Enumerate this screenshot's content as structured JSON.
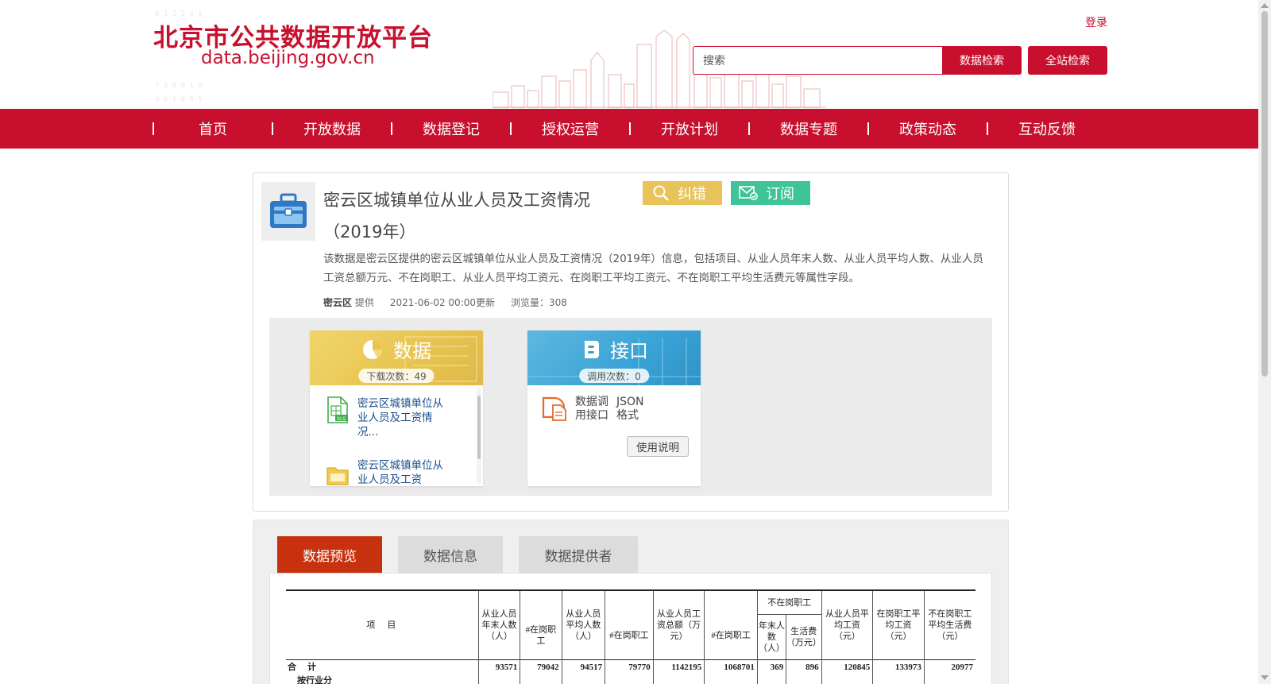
{
  "header": {
    "site_title": "北京市公共数据开放平台",
    "site_url": "data.beijing.gov.cn",
    "login_label": "登录",
    "search_placeholder": "搜索",
    "data_search_label": "数据检索",
    "site_search_label": "全站检索"
  },
  "nav": {
    "items": [
      "首页",
      "开放数据",
      "数据登记",
      "授权运营",
      "开放计划",
      "数据专题",
      "政策动态",
      "互动反馈"
    ]
  },
  "dataset": {
    "title": "密云区城镇单位从业人员及工资情况（2019年）",
    "correct_label": "纠错",
    "subscribe_label": "订阅",
    "description": "该数据是密云区提供的密云区城镇单位从业人员及工资情况（2019年）信息，包括项目、从业人员年末人数、从业人员平均人数、从业人员工资总额万元、不在岗职工、从业人员平均工资元、在岗职工平均工资元、不在岗职工平均生活费元等属性字段。",
    "provider": "密云区",
    "provider_suffix": "提供",
    "updated": "2021-06-02 00:00更新",
    "views": "浏览量：308",
    "data_panel": {
      "title": "数据",
      "badge": "下载次数：49",
      "files": [
        {
          "name": "密云区城镇单位从业人员及工资情况...",
          "icon": "xls-file-icon"
        },
        {
          "name": "密云区城镇单位从业人员及工资",
          "icon": "folder-file-icon"
        }
      ]
    },
    "api_panel": {
      "title": "接口",
      "badge": "调用次数：0",
      "api_name": "数据调用接口",
      "format": "JSON格式",
      "usage_label": "使用说明"
    }
  },
  "tabs": [
    "数据预览",
    "数据信息",
    "数据提供者"
  ],
  "preview_table": {
    "headers": {
      "item": "项　目",
      "year_end": "从业人员年末人数（人）",
      "year_end_onjob": "#在岗职工",
      "avg": "从业人员平均人数（人）",
      "avg_onjob": "#在岗职工",
      "total_wage": "从业人员工资总额（万元）",
      "total_wage_onjob": "#在岗职工",
      "offjob_group": "不在岗职工",
      "offjob_count": "年末人数（人）",
      "offjob_living": "生活费（万元）",
      "avg_wage": "从业人员平均工资（元）",
      "onjob_avg_wage": "在岗职工平均工资（元）",
      "offjob_avg_living": "不在岗职工平均生活费（元）"
    },
    "rows": [
      {
        "item": "合计",
        "values": [
          "93571",
          "79042",
          "94517",
          "79770",
          "1142195",
          "1068701",
          "369",
          "896",
          "120845",
          "133973",
          "20977"
        ]
      },
      {
        "item": "按行业分",
        "values": [
          "",
          "",
          "",
          "",
          "",
          "",
          "",
          "",
          "",
          "",
          ""
        ]
      }
    ]
  }
}
